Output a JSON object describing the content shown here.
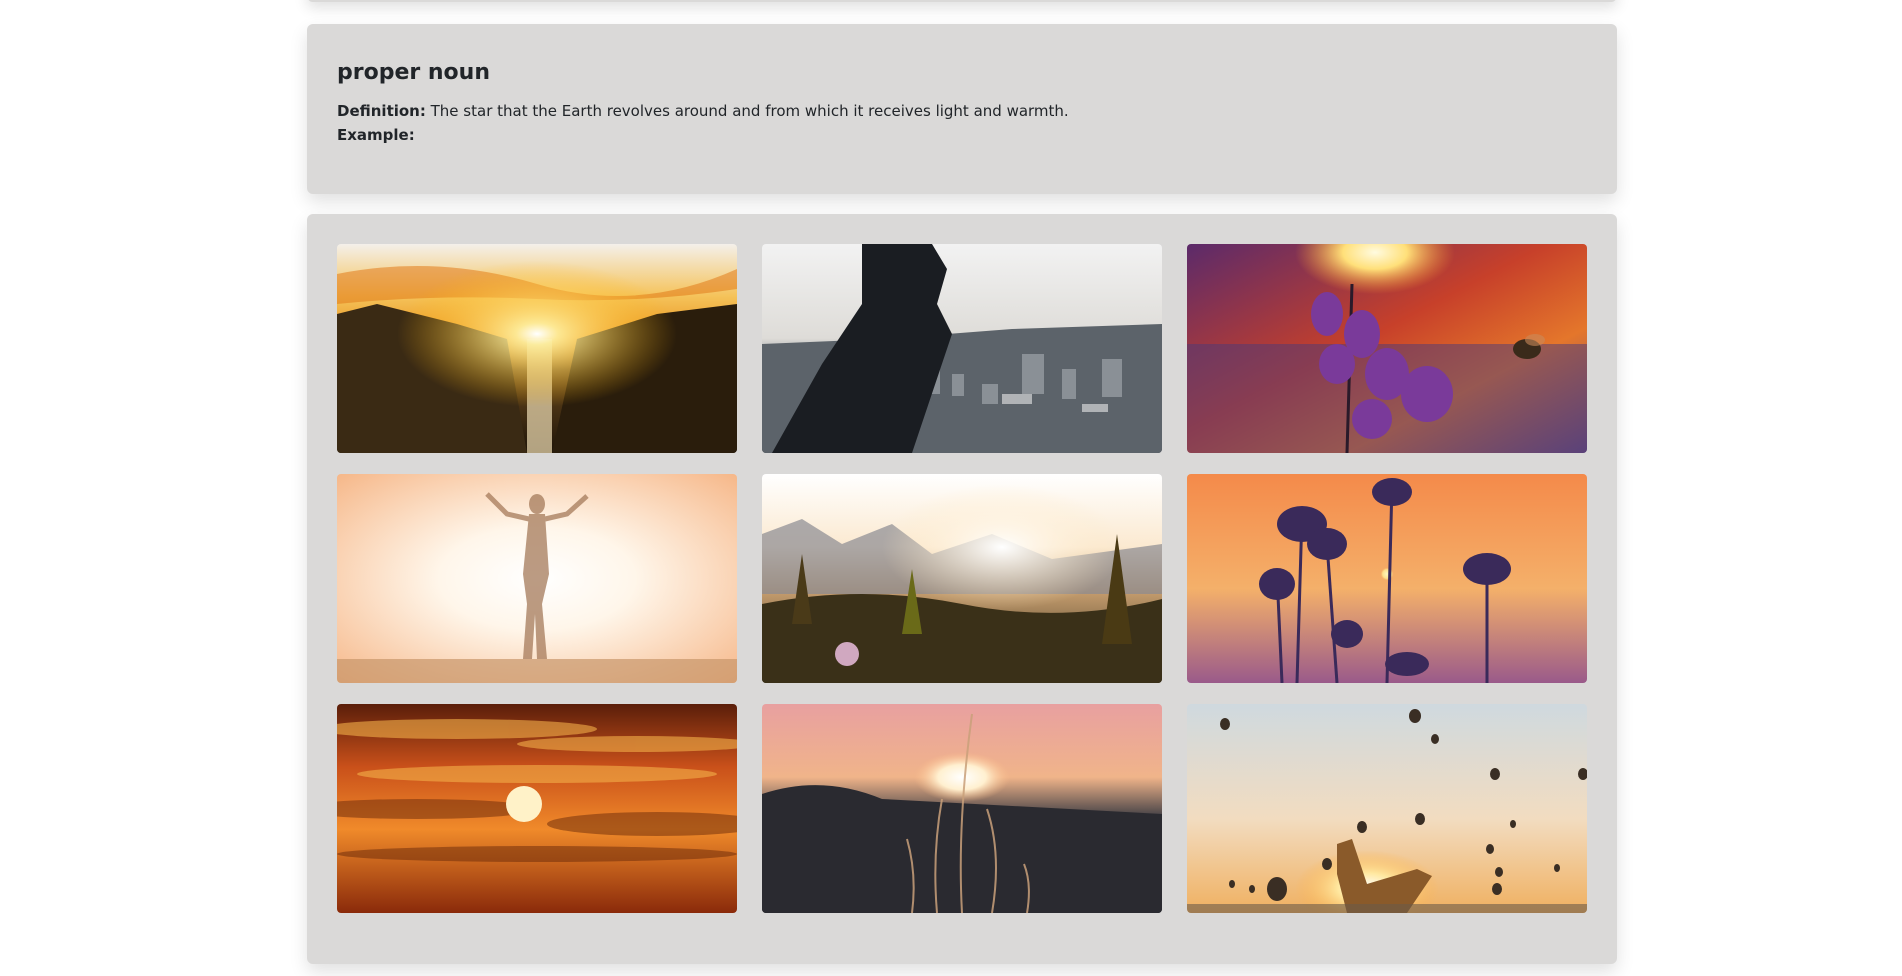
{
  "definition_card": {
    "part_of_speech": "proper noun",
    "definition_label": "Definition:",
    "definition_text": "The star that the Earth revolves around and from which it receives light and warmth.",
    "example_label": "Example:",
    "example_text": ""
  },
  "gallery": {
    "photos": [
      {
        "icon": "sunset-canyon-waterfall-photo"
      },
      {
        "icon": "hand-over-city-photo"
      },
      {
        "icon": "flower-and-bee-sunset-photo"
      },
      {
        "icon": "woman-silhouette-sunlight-photo"
      },
      {
        "icon": "mountain-forest-sunrise-photo"
      },
      {
        "icon": "plant-silhouettes-sun-photo"
      },
      {
        "icon": "orange-cloudy-sunset-photo"
      },
      {
        "icon": "grass-sunset-blur-photo"
      },
      {
        "icon": "hot-air-balloons-hand-sun-photo"
      }
    ]
  }
}
